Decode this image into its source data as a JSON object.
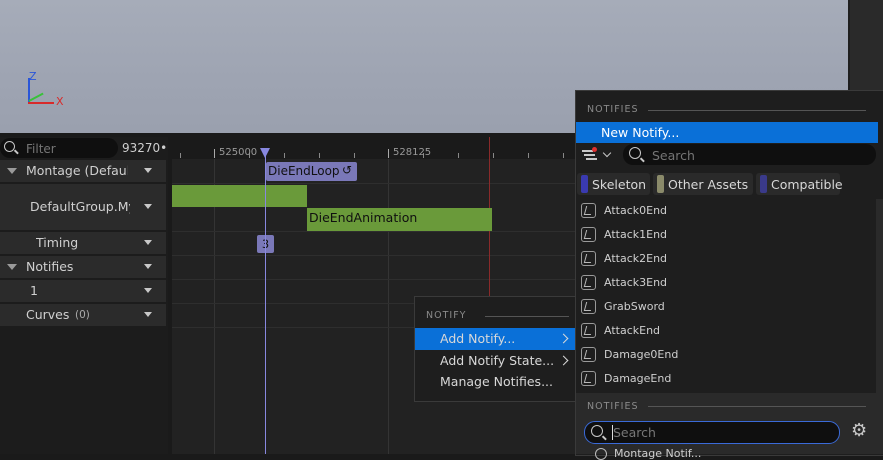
{
  "viewport": {
    "axis_x": "X",
    "axis_z": "Z"
  },
  "tracks": {
    "filter_placeholder": "Filter",
    "frame_value": "93270•",
    "rows": {
      "montage": "Montage (Default(",
      "group": "DefaultGroup.MyI",
      "timing": "Timing",
      "notifies": "Notifies",
      "notify_track": "1",
      "curves": "Curves",
      "curves_count": "(0)"
    }
  },
  "timeline": {
    "ruler_labels": [
      "525000",
      "528125"
    ],
    "section_label": "DieEndLoop",
    "animation_label": "DieEndAnimation",
    "timing_marker": "3"
  },
  "context_menu": {
    "header": "NOTIFY",
    "items": [
      "Add Notify...",
      "Add Notify State...",
      "Manage Notifies..."
    ]
  },
  "notify_picker": {
    "header": "NOTIFIES",
    "new_notify": "New Notify...",
    "search_placeholder": "Search",
    "filters": [
      {
        "label": "Skeleton",
        "color": "#3a3ab0"
      },
      {
        "label": "Other Assets",
        "color": "#8a8a6a"
      },
      {
        "label": "Compatible",
        "color": "#3a3a8a"
      }
    ],
    "items": [
      "Attack0End",
      "Attack1End",
      "Attack2End",
      "Attack3End",
      "GrabSword",
      "AttackEnd",
      "Damage0End",
      "DamageEnd"
    ],
    "footer_header": "NOTIFIES",
    "footer_search_value": "Search",
    "partial_item": "Montage Notif..."
  },
  "colors": {
    "accent_blue": "#0a70d8",
    "animation_green": "#6a9a3a",
    "section_purple": "#7a78b8",
    "playhead": "#8888e0"
  }
}
